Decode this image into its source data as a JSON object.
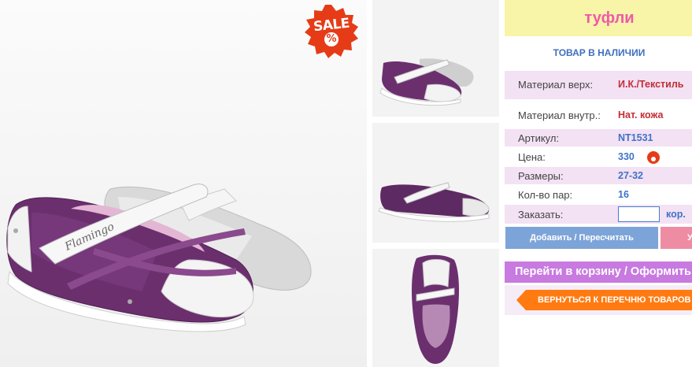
{
  "product": {
    "title": "туфли",
    "stock_status": "ТОВАР В НАЛИЧИИ",
    "sale_badge": "SALE",
    "sale_badge_symbol": "%",
    "brand_on_shoe": "Flamingo"
  },
  "specs": {
    "material_top_label": "Материал верх:",
    "material_top_value": "И.К./Текстиль",
    "material_inner_label": "Материал внутр.:",
    "material_inner_value": "Нат. кожа",
    "article_label": "Артикул:",
    "article_value": "NT1531",
    "price_label": "Цена:",
    "price_value": "330",
    "sizes_label": "Размеры:",
    "sizes_value": "27-32",
    "pairs_label": "Кол-во пар:",
    "pairs_value": "16",
    "order_label": "Заказать:",
    "order_value": "",
    "order_unit": "кор."
  },
  "buttons": {
    "add_label": "Добавить / Пересчитать",
    "remove_label": "У",
    "cart_label": "Перейти в корзину / Оформить",
    "back_label": "ВЕРНУТЬСЯ К ПЕРЕЧНЮ ТОВАРОВ"
  },
  "colors": {
    "title_bg": "#f8f4a8",
    "title_text": "#ee5aa9",
    "row_pink": "#f3e1f4",
    "value_blue": "#3f73c6",
    "value_red": "#c22e35",
    "add_button": "#7da4d8",
    "cart_button": "#c87ae0",
    "back_button": "#ff7b12",
    "sale_red": "#e53c17"
  },
  "icons": [
    "sale-badge-icon",
    "mini-sale-icon",
    "back-arrow-icon"
  ]
}
